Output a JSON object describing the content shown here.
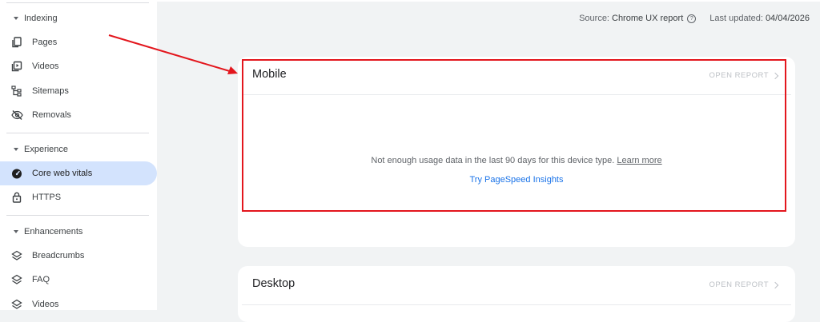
{
  "sidebar": {
    "indexing": {
      "title": "Indexing",
      "items": [
        {
          "label": "Pages",
          "icon": "pages-icon"
        },
        {
          "label": "Videos",
          "icon": "video-icon"
        },
        {
          "label": "Sitemaps",
          "icon": "sitemap-icon"
        },
        {
          "label": "Removals",
          "icon": "eye-off-icon"
        }
      ]
    },
    "experience": {
      "title": "Experience",
      "items": [
        {
          "label": "Core web vitals",
          "icon": "speedometer-icon",
          "active": true
        },
        {
          "label": "HTTPS",
          "icon": "lock-icon"
        }
      ]
    },
    "enhancements": {
      "title": "Enhancements",
      "items": [
        {
          "label": "Breadcrumbs",
          "icon": "layers-icon"
        },
        {
          "label": "FAQ",
          "icon": "layers-icon"
        },
        {
          "label": "Videos",
          "icon": "layers-icon"
        }
      ]
    }
  },
  "meta": {
    "source_label": "Source:",
    "source_value": "Chrome UX report",
    "updated_label": "Last updated:",
    "updated_value": "04/04/2026",
    "help_glyph": "?"
  },
  "mobile_card": {
    "title": "Mobile",
    "open_report": "OPEN REPORT",
    "message": "Not enough usage data in the last 90 days for this device type.",
    "learn_more": "Learn more",
    "psi_link": "Try PageSpeed Insights"
  },
  "desktop_card": {
    "title": "Desktop",
    "open_report": "OPEN REPORT"
  },
  "colors": {
    "annotation": "#e3161d",
    "active_nav": "#d3e3fd",
    "link": "#1a73e8"
  }
}
